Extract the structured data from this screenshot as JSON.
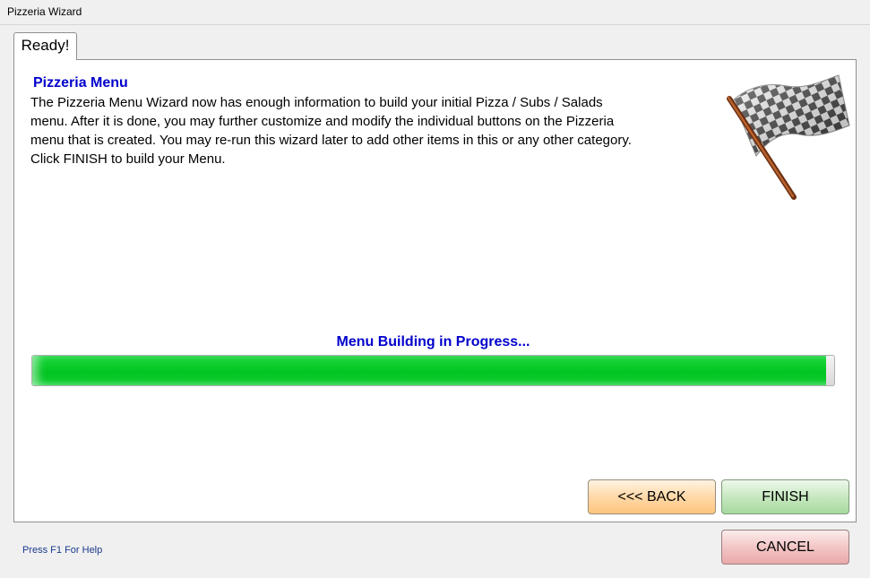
{
  "window": {
    "title": "Pizzeria Wizard"
  },
  "tab": {
    "label": "Ready!"
  },
  "content": {
    "heading": "Pizzeria Menu",
    "description": "The Pizzeria Menu Wizard now has enough information to build your initial Pizza / Subs / Salads menu.  After it is done, you may further customize and modify the individual buttons on the Pizzeria menu that is created.  You may re-run this wizard later to add other items in this or any other category.  Click FINISH to build your Menu.",
    "icon": "checkered-flag-icon"
  },
  "progress": {
    "label": "Menu Building in Progress...",
    "value_percent": 99,
    "color": "#00c421"
  },
  "buttons": {
    "back": "<<< BACK",
    "finish": "FINISH",
    "cancel": "CANCEL"
  },
  "footer": {
    "help": "Press F1 For Help"
  },
  "colors": {
    "heading": "#0000cc",
    "back_button": "#fec57c",
    "finish_button": "#a8d99f",
    "cancel_button": "#eaa8aa"
  }
}
